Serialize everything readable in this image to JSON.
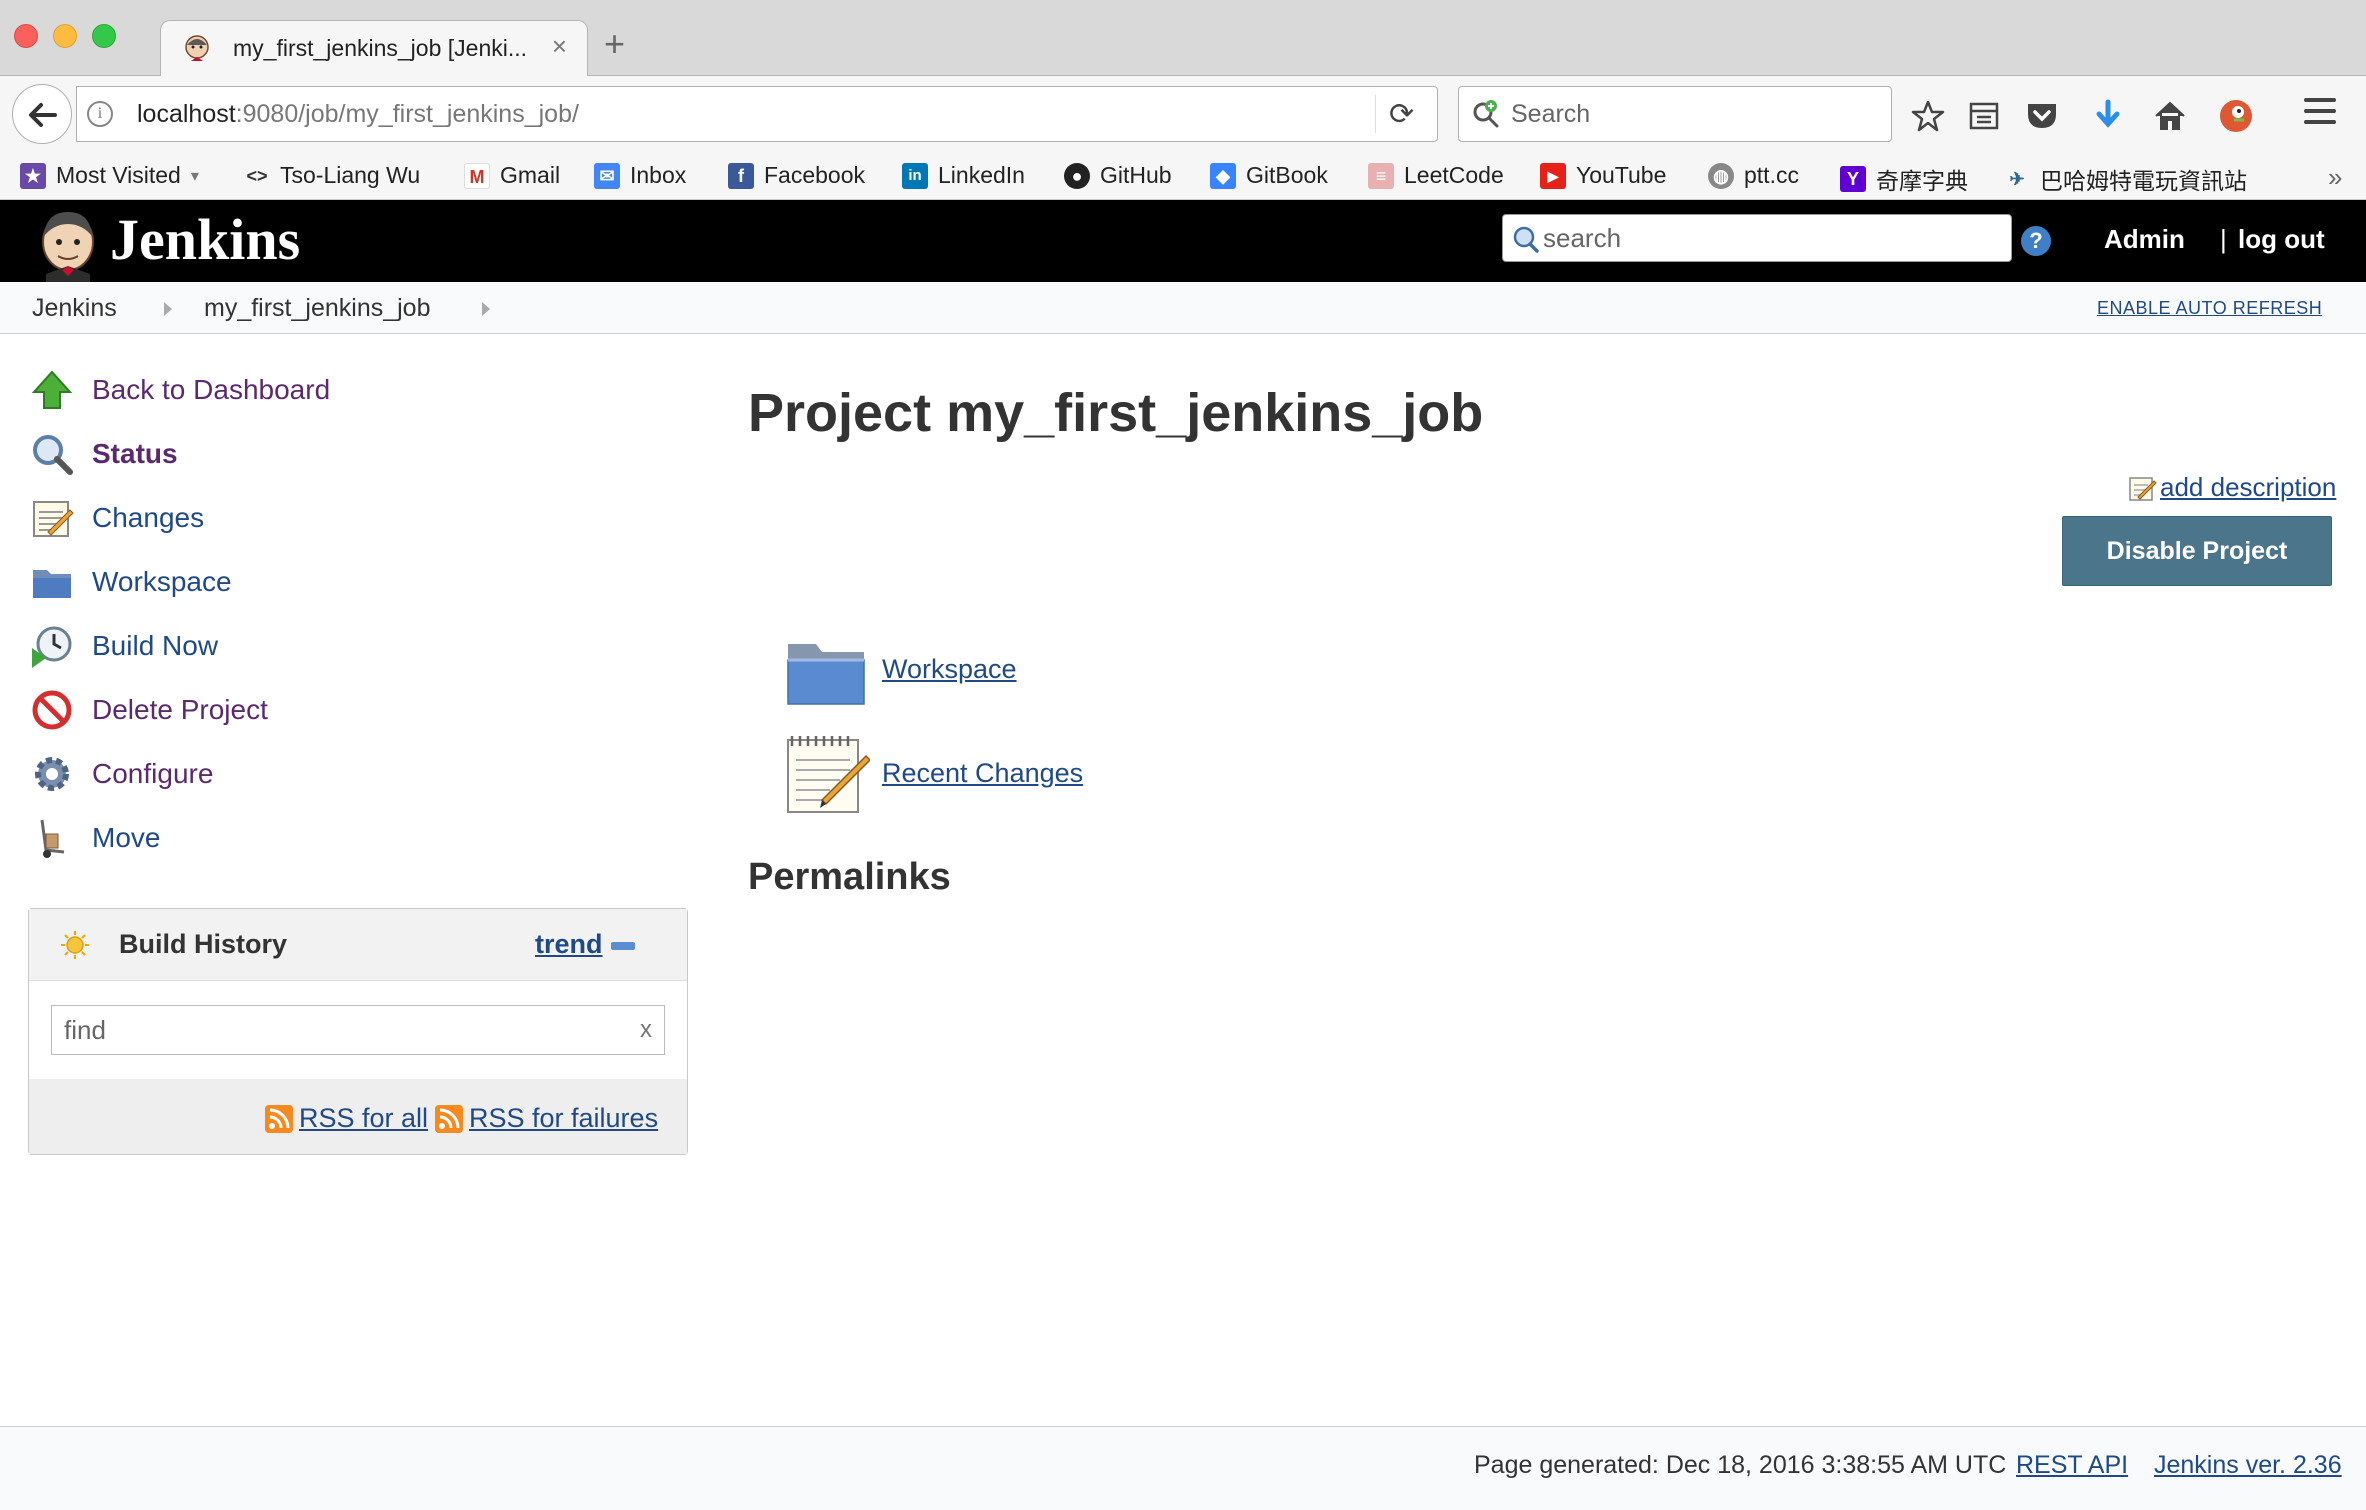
{
  "browser": {
    "tab_title": "my_first_jenkins_job [Jenki...",
    "tab_close": "×",
    "new_tab": "+",
    "url_host": "localhost",
    "url_rest": ":9080/job/my_first_jenkins_job/",
    "search_placeholder": "Search",
    "bookmarks": [
      {
        "label": "Most Visited",
        "icon": "most-visited-icon"
      },
      {
        "label": "Tso-Liang Wu",
        "icon": "code-icon"
      },
      {
        "label": "Gmail",
        "icon": "gmail-icon"
      },
      {
        "label": "Inbox",
        "icon": "inbox-icon"
      },
      {
        "label": "Facebook",
        "icon": "facebook-icon"
      },
      {
        "label": "LinkedIn",
        "icon": "linkedin-icon"
      },
      {
        "label": "GitHub",
        "icon": "github-icon"
      },
      {
        "label": "GitBook",
        "icon": "gitbook-icon"
      },
      {
        "label": "LeetCode",
        "icon": "leetcode-icon"
      },
      {
        "label": "YouTube",
        "icon": "youtube-icon"
      },
      {
        "label": "ptt.cc",
        "icon": "globe-icon"
      },
      {
        "label": "奇摩字典",
        "icon": "yahoo-icon"
      },
      {
        "label": "巴哈姆特電玩資訊站",
        "icon": "bahamut-icon"
      }
    ],
    "bookmarks_more": "»"
  },
  "jenkins": {
    "title": "Jenkins",
    "search_placeholder": "search",
    "help": "?",
    "user": "Admin",
    "separator": "|",
    "logout": "log out"
  },
  "breadcrumb": {
    "items": [
      "Jenkins",
      "my_first_jenkins_job"
    ],
    "auto_refresh": "ENABLE AUTO REFRESH"
  },
  "sidepanel": {
    "tasks": [
      {
        "label": "Back to Dashboard",
        "icon": "up-arrow-icon"
      },
      {
        "label": "Status",
        "icon": "magnifier-icon"
      },
      {
        "label": "Changes",
        "icon": "notepad-icon"
      },
      {
        "label": "Workspace",
        "icon": "folder-icon"
      },
      {
        "label": "Build Now",
        "icon": "clock-icon"
      },
      {
        "label": "Delete Project",
        "icon": "no-entry-icon"
      },
      {
        "label": "Configure",
        "icon": "gear-icon"
      },
      {
        "label": "Move",
        "icon": "hand-truck-icon"
      }
    ]
  },
  "build_history": {
    "title": "Build History",
    "trend": "trend",
    "find_placeholder": "find",
    "clear": "x",
    "rss_all": "RSS for all",
    "rss_failures": "RSS for failures"
  },
  "main": {
    "title": "Project my_first_jenkins_job",
    "add_description": "add description",
    "disable_button": "Disable Project",
    "links": [
      {
        "label": "Workspace",
        "icon": "folder-icon"
      },
      {
        "label": "Recent Changes",
        "icon": "notepad-icon"
      }
    ],
    "permalinks_heading": "Permalinks"
  },
  "footer": {
    "generated": "Page generated: Dec 18, 2016 3:38:55 AM UTC",
    "rest_api": "REST API",
    "version": "Jenkins ver. 2.36"
  },
  "colors": {
    "link": "#204a87",
    "visited": "#5b2a6e",
    "header_bg": "#000000",
    "disable_button": "#4b758b"
  }
}
